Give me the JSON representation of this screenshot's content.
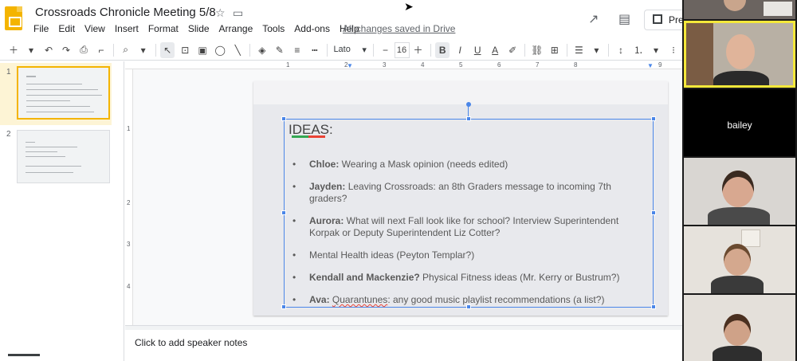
{
  "header": {
    "title": "Crossroads Chronicle Meeting 5/8",
    "saved_status": "All changes saved in Drive",
    "present_label": "Pre",
    "menu": [
      "File",
      "Edit",
      "View",
      "Insert",
      "Format",
      "Slide",
      "Arrange",
      "Tools",
      "Add-ons",
      "Help"
    ]
  },
  "toolbar": {
    "font": "Lato",
    "font_size": "16"
  },
  "filmstrip": {
    "slides": [
      {
        "number": "1"
      },
      {
        "number": "2"
      }
    ]
  },
  "ruler": {
    "h_numbers": [
      "1",
      "2",
      "3",
      "4",
      "5",
      "6",
      "7",
      "8",
      "9"
    ],
    "v_numbers": [
      "1",
      "2",
      "3",
      "4"
    ]
  },
  "slide": {
    "title": "IDEAS:",
    "bullets": [
      {
        "name": "Chloe:",
        "text": " Wearing a Mask opinion (needs edited)"
      },
      {
        "name": "Jayden:",
        "text": " Leaving Crossroads: an 8th Graders message to incoming 7th graders?"
      },
      {
        "name": "Aurora:",
        "text": " What will next Fall look like for school?  Interview Superintendent Korpak or Deputy Superintendent Liz Cotter?"
      },
      {
        "name": "",
        "text": "Mental Health ideas (Peyton Templar?)"
      },
      {
        "name": "Kendall and Mackenzie?",
        "text": " Physical Fitness ideas (Mr. Kerry or Bustrum?)"
      },
      {
        "name": "Ava:",
        "text": " any good music playlist recommendations (a list?)",
        "highlight": "Quarantunes"
      }
    ]
  },
  "notes": {
    "placeholder": "Click to add speaker notes"
  },
  "video": {
    "participants": [
      {
        "name": ""
      },
      {
        "name": ""
      },
      {
        "name": "bailey"
      },
      {
        "name": ""
      },
      {
        "name": ""
      },
      {
        "name": ""
      }
    ]
  },
  "colors": {
    "brand": "#f4b400",
    "selection": "#4a86e8",
    "speaking_border": "#f4e83a"
  }
}
